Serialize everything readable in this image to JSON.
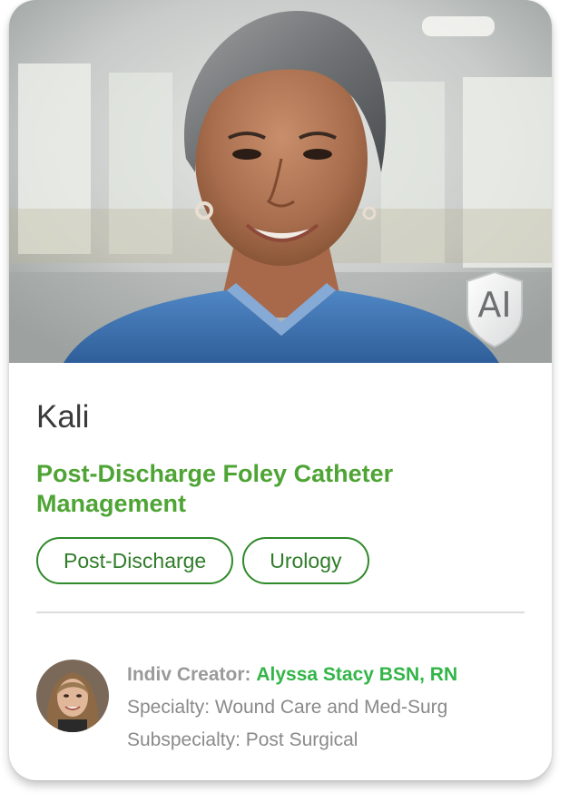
{
  "card": {
    "ai_badge": "AI",
    "name": "Kali",
    "title": "Post-Discharge Foley Catheter Management",
    "tags": [
      "Post-Discharge",
      "Urology"
    ],
    "creator": {
      "label": "Indiv Creator:",
      "name": "Alyssa Stacy BSN, RN",
      "specialty": "Specialty: Wound Care and Med-Surg",
      "subspecialty": "Subspecialty: Post Surgical"
    }
  },
  "colors": {
    "title_green": "#4ea434",
    "tag_border": "#2f8a2a",
    "creator_green": "#33b548"
  }
}
